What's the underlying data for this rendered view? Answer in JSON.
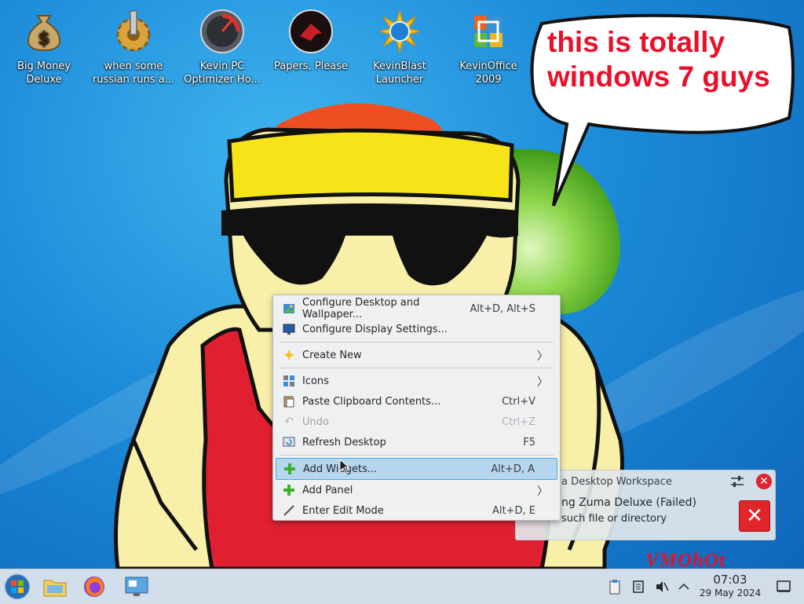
{
  "desktop": {
    "icons": [
      {
        "name": "big-money-deluxe",
        "icon": "money-bag-icon",
        "line1": "Big Money",
        "line2": "Deluxe"
      },
      {
        "name": "when-some-russian",
        "icon": "gear-icon",
        "line1": "when some",
        "line2": "russian runs a..."
      },
      {
        "name": "kevin-pc-optimizer",
        "icon": "gauge-icon",
        "line1": "Kevin PC",
        "line2": "Optimizer Ho..."
      },
      {
        "name": "papers-please",
        "icon": "papers-please-seal-icon",
        "line1": "Papers, Please",
        "line2": ""
      },
      {
        "name": "kevinblast-launcher",
        "icon": "starburst-globe-icon",
        "line1": "KevinBlast",
        "line2": "Launcher"
      },
      {
        "name": "kevinoffice-2009",
        "icon": "office-logo-icon",
        "line1": "KevinOffice",
        "line2": "2009"
      }
    ]
  },
  "bubble": {
    "line1": "this is totally",
    "line2": "windows 7 guys"
  },
  "context_menu": {
    "items": [
      {
        "label": "Configure Desktop and Wallpaper...",
        "shortcut": "Alt+D, Alt+S",
        "icon": "wallpaper-icon"
      },
      {
        "label": "Configure Display Settings...",
        "shortcut": "",
        "icon": "display-icon"
      },
      {
        "label": "Create New",
        "shortcut": "",
        "icon": "create-new-icon"
      },
      {
        "label": "Icons",
        "shortcut": "",
        "icon": "icons-icon"
      },
      {
        "label": "Paste Clipboard Contents...",
        "shortcut": "Ctrl+V",
        "icon": "paste-icon"
      },
      {
        "label": "Undo",
        "shortcut": "Ctrl+Z",
        "icon": "undo-icon"
      },
      {
        "label": "Refresh Desktop",
        "shortcut": "F5",
        "icon": "refresh-icon"
      },
      {
        "label": "Add Widgets...",
        "shortcut": "Alt+D, A",
        "icon": "plus-icon"
      },
      {
        "label": "Add Panel",
        "shortcut": "",
        "icon": "plus-icon"
      },
      {
        "label": "Enter Edit Mode",
        "shortcut": "Alt+D, E",
        "icon": "edit-mode-icon"
      }
    ]
  },
  "notification": {
    "title": "a Desktop Workspace",
    "heading": "ng Zuma Deluxe (Failed)",
    "body": "such file or directory"
  },
  "watermark": "VMOhOt",
  "taskbar": {
    "time": "07:03",
    "date": "29 May 2024"
  },
  "colors": {
    "accent": "#3daee9",
    "highlight": "#b6d6ee",
    "bubble_text": "#e8102a",
    "error": "#e1262b"
  }
}
